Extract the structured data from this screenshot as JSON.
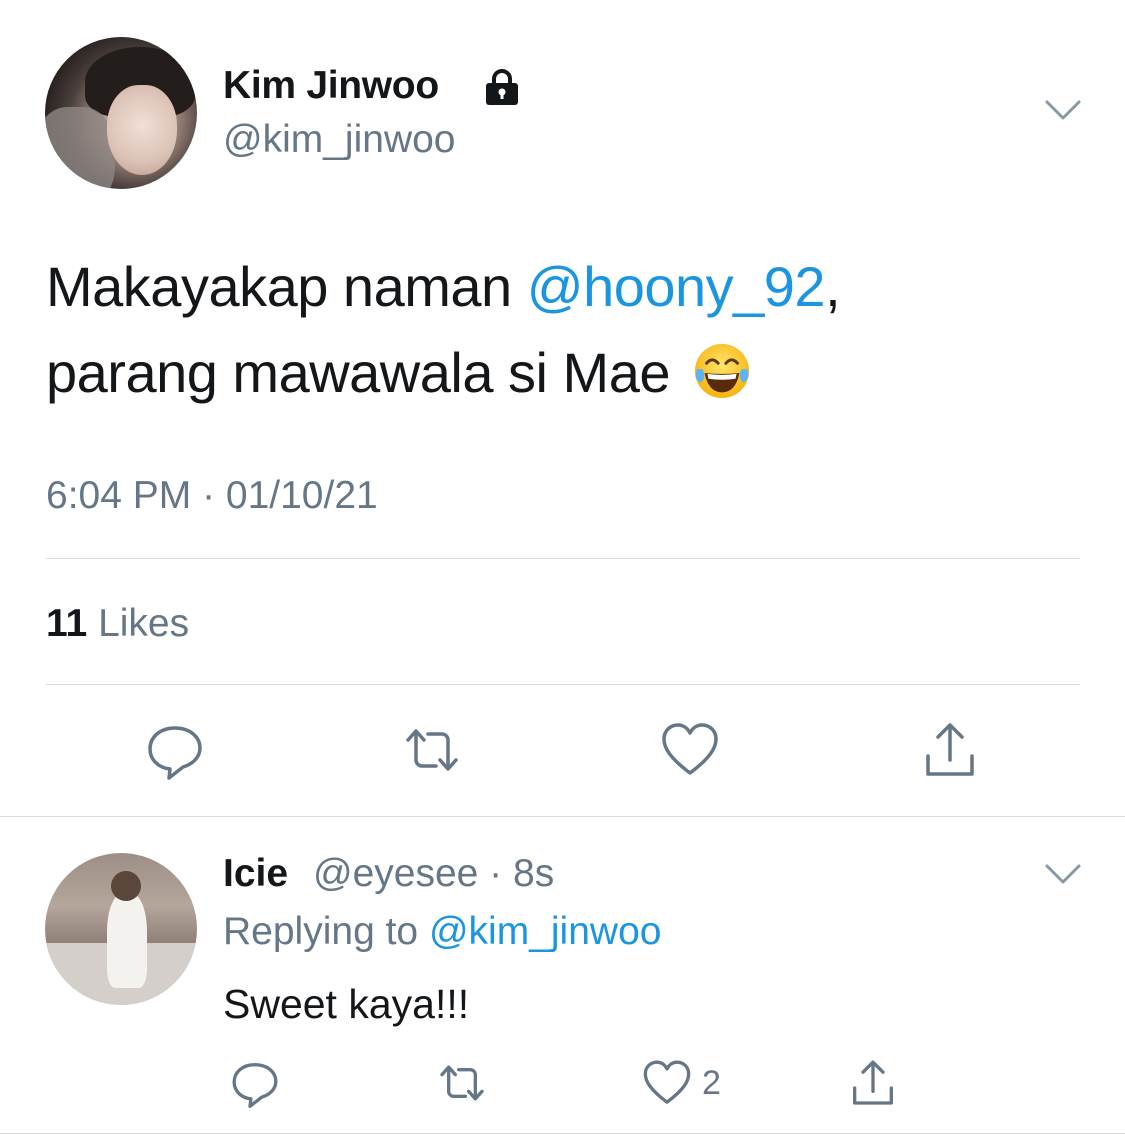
{
  "tweet": {
    "author_name": "Kim Jinwoo",
    "author_handle": "@kim_jinwoo",
    "text_part1": "Makayakap naman ",
    "mention": "@hoony_92",
    "text_part2": ",",
    "text_line2": "parang mawawala si Mae",
    "emoji": "face-with-tears-of-joy",
    "timestamp": "6:04 PM · 01/10/21",
    "likes_count": "11",
    "likes_label": "Likes"
  },
  "reply": {
    "author_name": "Icie",
    "author_handle_time": "@eyesee · 8s",
    "replying_prefix": "Replying to ",
    "replying_to": "@kim_jinwoo",
    "text": "Sweet kaya!!!",
    "like_count": "2"
  },
  "icons": {
    "lock": "lock-icon",
    "chevron": "chevron-down-icon",
    "reply": "reply-icon",
    "retweet": "retweet-icon",
    "like": "heart-icon",
    "share": "share-icon"
  },
  "colors": {
    "text": "#14171a",
    "secondary": "#657786",
    "link": "#1b95e0",
    "divider": "#d7dde2"
  }
}
